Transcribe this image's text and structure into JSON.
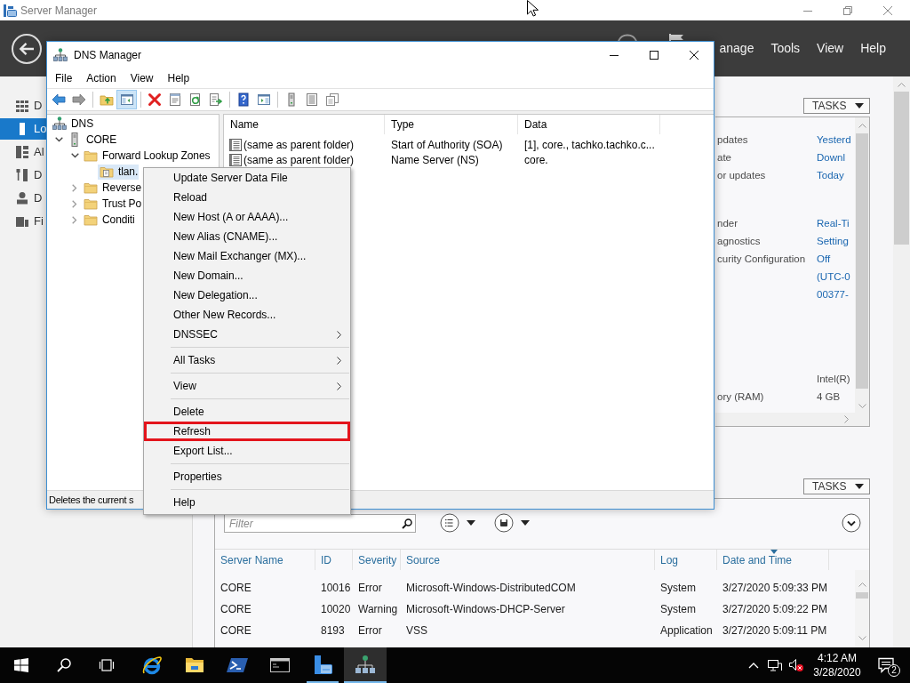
{
  "server_manager": {
    "title": "Server Manager",
    "menu": [
      "anage",
      "Tools",
      "View",
      "Help"
    ],
    "sidebar": [
      {
        "label": "D",
        "selected": false
      },
      {
        "label": "Lo",
        "selected": true
      },
      {
        "label": "Al",
        "selected": false
      },
      {
        "label": "D",
        "selected": false
      },
      {
        "label": "D",
        "selected": false
      },
      {
        "label": "Fi",
        "selected": false
      }
    ],
    "properties": {
      "tasks_button": "TASKS",
      "groups": [
        [
          {
            "label": "pdates",
            "value": "Yesterd",
            "link": true
          },
          {
            "label": "ate",
            "value": "Downl",
            "link": true
          },
          {
            "label": "or updates",
            "value": "Today",
            "link": true
          }
        ],
        [
          {
            "label": "nder",
            "value": "Real-Ti",
            "link": true
          },
          {
            "label": "agnostics",
            "value": "Setting",
            "link": true
          },
          {
            "label": "curity Configuration",
            "value": "Off",
            "link": true
          },
          {
            "value": "(UTC-0",
            "link": true
          },
          {
            "value": "00377-",
            "link": true
          }
        ],
        [
          {
            "value": "Intel(R)",
            "link": false
          },
          {
            "label": "ory (RAM)",
            "value": "4 GB",
            "link": false
          }
        ]
      ]
    },
    "events": {
      "tasks_button": "TASKS",
      "filter": {
        "placeholder": "Filter"
      },
      "columns": [
        {
          "label": "Server Name",
          "sorted": false
        },
        {
          "label": "ID",
          "sorted": false
        },
        {
          "label": "Severity",
          "sorted": false
        },
        {
          "label": "Source",
          "sorted": false
        },
        {
          "label": "Log",
          "sorted": false
        },
        {
          "label": "Date and Time",
          "sorted": true
        }
      ],
      "rows": [
        [
          "CORE",
          "10016",
          "Error",
          "Microsoft-Windows-DistributedCOM",
          "System",
          "3/27/2020 5:09:33 PM"
        ],
        [
          "CORE",
          "10020",
          "Warning",
          "Microsoft-Windows-DHCP-Server",
          "System",
          "3/27/2020 5:09:22 PM"
        ],
        [
          "CORE",
          "8193",
          "Error",
          "VSS",
          "Application",
          "3/27/2020 5:09:11 PM"
        ]
      ]
    }
  },
  "dns_manager": {
    "title": "DNS Manager",
    "menu": [
      "File",
      "Action",
      "View",
      "Help"
    ],
    "toolbar": [
      {
        "pressed": false
      },
      {
        "pressed": false
      },
      {
        "pressed": false
      },
      {
        "pressed": true
      },
      {
        "pressed": false
      },
      {
        "pressed": false
      },
      {
        "pressed": false
      },
      {
        "pressed": false
      },
      {
        "pressed": false
      },
      {
        "pressed": false
      },
      {
        "pressed": false
      },
      {
        "pressed": false
      },
      {
        "pressed": false
      }
    ],
    "tree": [
      {
        "label": "DNS",
        "kind": "root",
        "selected": false,
        "children": [
          {
            "label": "CORE",
            "kind": "server",
            "expanded": true,
            "selected": false,
            "children": [
              {
                "label": "Forward Lookup Zones",
                "kind": "folder",
                "expanded": true,
                "selected": false,
                "children": [
                  {
                    "label": "tlan.",
                    "kind": "zone",
                    "selected": true
                  }
                ]
              },
              {
                "label": "Reverse",
                "kind": "folder",
                "expanded": false,
                "selected": false
              },
              {
                "label": "Trust Po",
                "kind": "folder",
                "expanded": false,
                "selected": false
              },
              {
                "label": "Conditi",
                "kind": "folder",
                "expanded": false,
                "selected": false
              }
            ]
          }
        ]
      }
    ],
    "list": {
      "columns": [
        "Name",
        "Type",
        "Data"
      ],
      "rows": [
        {
          "name": "(same as parent folder)",
          "type": "Start of Authority (SOA)",
          "data": "[1], core., tachko.tachko.c..."
        },
        {
          "name": "(same as parent folder)",
          "type": "Name Server (NS)",
          "data": "core."
        }
      ]
    },
    "status": "Deletes the current s"
  },
  "context_menu": {
    "items": [
      {
        "kind": "item",
        "label": "Update Server Data File",
        "submenu": false,
        "boxed": false
      },
      {
        "kind": "item",
        "label": "Reload",
        "submenu": false,
        "boxed": false
      },
      {
        "kind": "item",
        "label": "New Host (A or AAAA)...",
        "submenu": false,
        "boxed": false
      },
      {
        "kind": "item",
        "label": "New Alias (CNAME)...",
        "submenu": false,
        "boxed": false
      },
      {
        "kind": "item",
        "label": "New Mail Exchanger (MX)...",
        "submenu": false,
        "boxed": false
      },
      {
        "kind": "item",
        "label": "New Domain...",
        "submenu": false,
        "boxed": false
      },
      {
        "kind": "item",
        "label": "New Delegation...",
        "submenu": false,
        "boxed": false
      },
      {
        "kind": "item",
        "label": "Other New Records...",
        "submenu": false,
        "boxed": false
      },
      {
        "kind": "item",
        "label": "DNSSEC",
        "submenu": true,
        "boxed": false
      },
      {
        "kind": "separator"
      },
      {
        "kind": "item",
        "label": "All Tasks",
        "submenu": true,
        "boxed": false
      },
      {
        "kind": "separator"
      },
      {
        "kind": "item",
        "label": "View",
        "submenu": true,
        "boxed": false
      },
      {
        "kind": "separator"
      },
      {
        "kind": "item",
        "label": "Delete",
        "submenu": false,
        "boxed": false
      },
      {
        "kind": "item",
        "label": "Refresh",
        "submenu": false,
        "boxed": true
      },
      {
        "kind": "item",
        "label": "Export List...",
        "submenu": false,
        "boxed": false
      },
      {
        "kind": "separator"
      },
      {
        "kind": "item",
        "label": "Properties",
        "submenu": false,
        "boxed": false
      },
      {
        "kind": "separator"
      },
      {
        "kind": "item",
        "label": "Help",
        "submenu": false,
        "boxed": false
      }
    ]
  },
  "taskbar": {
    "apps": [
      {
        "open": false,
        "selected": false
      },
      {
        "open": false,
        "selected": false
      },
      {
        "open": false,
        "selected": false
      },
      {
        "open": false,
        "selected": false
      },
      {
        "open": true,
        "selected": false
      },
      {
        "open": true,
        "selected": true
      }
    ],
    "clock": {
      "time": "4:12 AM",
      "date": "3/28/2020"
    },
    "notifications": "2"
  }
}
